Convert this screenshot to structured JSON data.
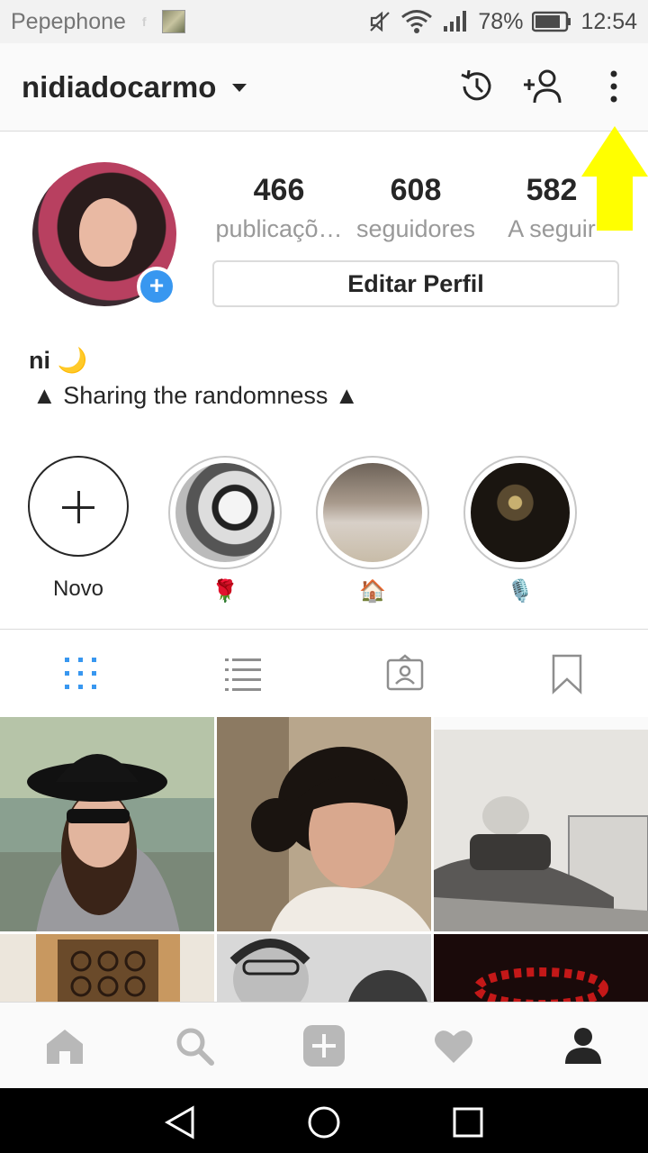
{
  "status_bar": {
    "carrier": "Pepephone",
    "battery": "78%",
    "time": "12:54"
  },
  "header": {
    "username": "nidiadocarmo",
    "icons": [
      "archive-history-icon",
      "add-person-icon",
      "more-vertical-icon"
    ]
  },
  "profile": {
    "stats": [
      {
        "value": "466",
        "label": "publicaçõ…"
      },
      {
        "value": "608",
        "label": "seguidores"
      },
      {
        "value": "582",
        "label": "A seguir"
      }
    ],
    "edit_button": "Editar Perfil",
    "name": "ni 🌙",
    "bio": "▲ Sharing the randomness ▲"
  },
  "highlights": [
    {
      "label": "Novo"
    },
    {
      "label": "🌹"
    },
    {
      "label": "🏠"
    },
    {
      "label": "🎙️"
    }
  ],
  "tabs": [
    "grid-icon",
    "list-icon",
    "tagged-icon",
    "saved-icon"
  ],
  "bottom_nav": [
    "home-icon",
    "search-icon",
    "add-post-icon",
    "activity-heart-icon",
    "profile-icon"
  ],
  "colors": {
    "accent": "#3897f0",
    "annotation": "#ffff00",
    "text": "#262626",
    "muted": "#999999"
  }
}
